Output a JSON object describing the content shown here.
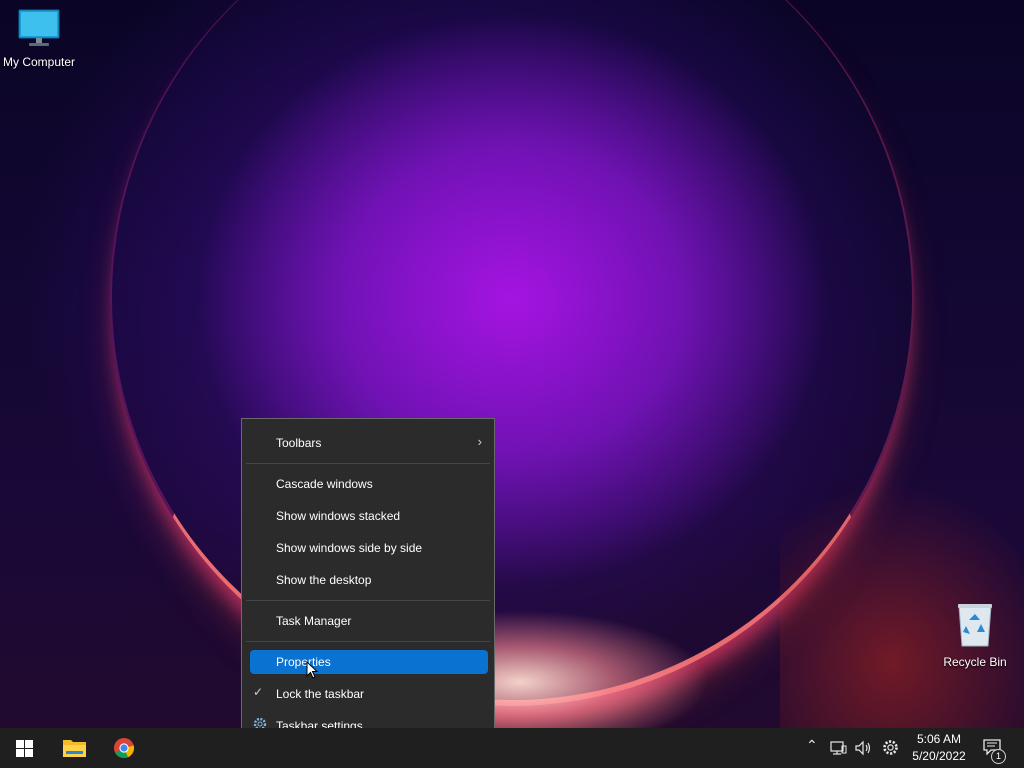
{
  "desktop": {
    "icons": [
      {
        "label": "My Computer"
      },
      {
        "label": "Recycle Bin"
      }
    ]
  },
  "context_menu": {
    "items": [
      {
        "label": "Toolbars",
        "submenu": true
      },
      {
        "label": "Cascade windows"
      },
      {
        "label": "Show windows stacked"
      },
      {
        "label": "Show windows side by side"
      },
      {
        "label": "Show the desktop"
      },
      {
        "label": "Task Manager"
      },
      {
        "label": "Properties",
        "highlighted": true
      },
      {
        "label": "Lock the taskbar",
        "checked": true
      },
      {
        "label": "Taskbar settings",
        "icon": "gear-icon"
      }
    ]
  },
  "taskbar": {
    "clock": {
      "time": "5:06 AM",
      "date": "5/20/2022"
    },
    "notifications_count": "1",
    "accent_color": "#0a72d1"
  }
}
